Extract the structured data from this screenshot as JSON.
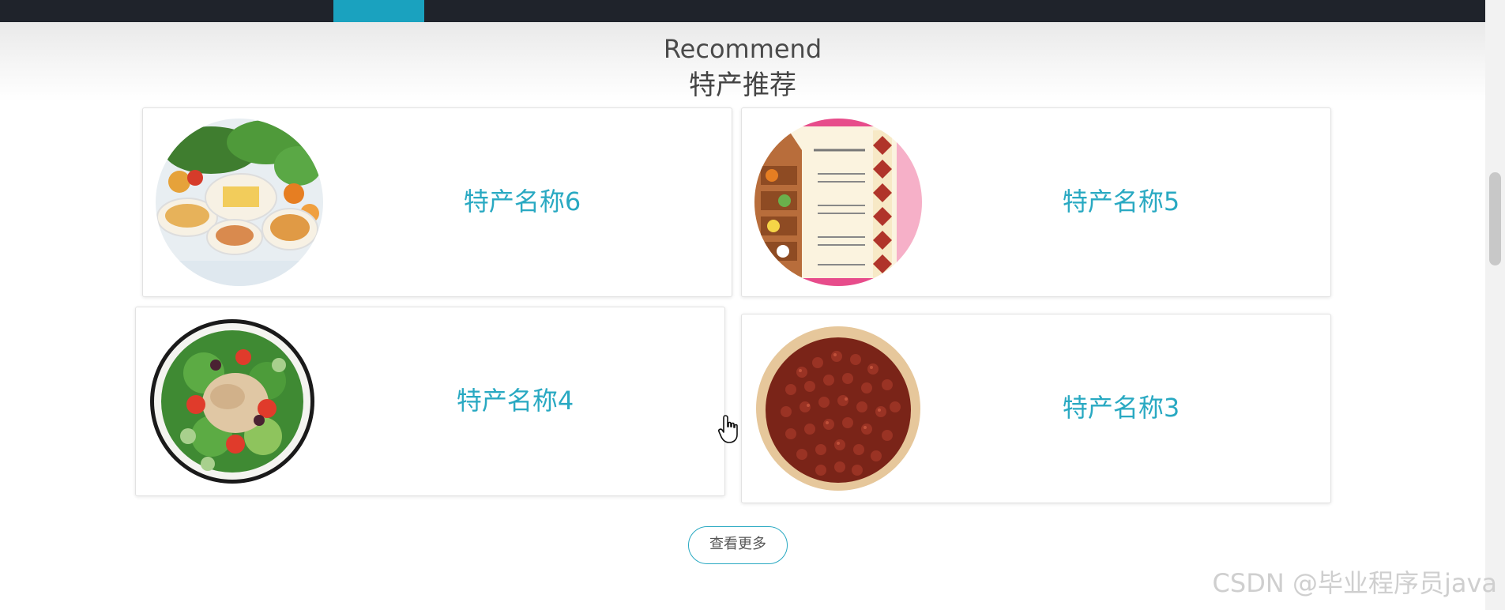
{
  "section": {
    "title_en": "Recommend",
    "title_cn": "特产推荐"
  },
  "products": [
    {
      "name": "特产名称6",
      "image_icon": "vegetable-platter-image"
    },
    {
      "name": "特产名称5",
      "image_icon": "poster-image"
    },
    {
      "name": "特产名称4",
      "image_icon": "salad-image"
    },
    {
      "name": "特产名称3",
      "image_icon": "red-beans-image"
    }
  ],
  "more_button": {
    "label": "查看更多"
  },
  "watermark": "CSDN @毕业程序员java",
  "colors": {
    "accent": "#29a9c2",
    "topbar": "#1f232b",
    "active_tab": "#1aa2bf"
  }
}
